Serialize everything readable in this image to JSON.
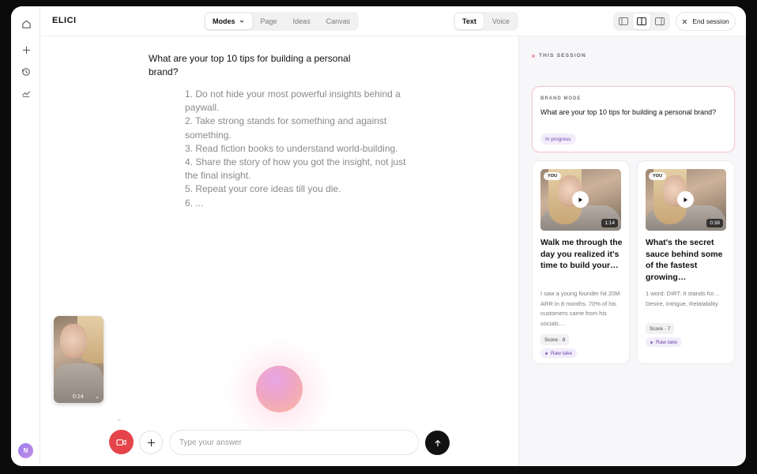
{
  "app": {
    "logo": "ELICI"
  },
  "header": {
    "modes_tabs": [
      {
        "label": "Modes",
        "active": true
      },
      {
        "label": "Page",
        "active": false
      },
      {
        "label": "Ideas",
        "active": false
      },
      {
        "label": "Canvas",
        "active": false
      }
    ],
    "input_tabs": [
      {
        "label": "Text",
        "active": true
      },
      {
        "label": "Voice",
        "active": false
      }
    ],
    "end_session_label": "End session"
  },
  "sidebar": {
    "icons": [
      "home-icon",
      "plus-icon",
      "history-icon",
      "trend-icon"
    ],
    "avatar_initial": "N"
  },
  "main": {
    "question": "What are your top 10 tips for building a personal brand?",
    "answer_lines": [
      "1. Do not hide your most powerful insights behind a paywall.",
      "2. Take strong stands for something and against something.",
      "3. Read fiction books to understand world-building.",
      "4. Share the story of how you got the insight, not just the final insight.",
      "5. Repeat your core ideas till you die.",
      "6. ..."
    ],
    "self_video_time": "0:14",
    "input_placeholder": "Type your answer"
  },
  "panel": {
    "session_label": "THIS SESSION",
    "brand_card": {
      "mode": "BRAND MODE",
      "question": "What are your top 10 tips for building a personal brand?",
      "status": "In progress"
    },
    "takes": [
      {
        "badge": "YOU",
        "duration": "1:14",
        "title": "Walk me through the day you realized it's time to build your…",
        "snippet": "I saw a young founder hit 20M ARR in 8 months. 70% of his customers came from his socials.…",
        "score": "Score · 8",
        "raw_label": "Raw take"
      },
      {
        "badge": "YOU",
        "duration": "0:38",
        "title": "What's the secret sauce behind some of the fastest growing…",
        "snippet": "1 word: DIRT. It stands for… Desire, Intrigue, Relatability",
        "score": "Score · 7",
        "raw_label": "Raw take"
      }
    ]
  },
  "colors": {
    "accent_pink": "#f39bb4",
    "record_red": "#e5454a",
    "status_purple": "#6b4aa8"
  }
}
